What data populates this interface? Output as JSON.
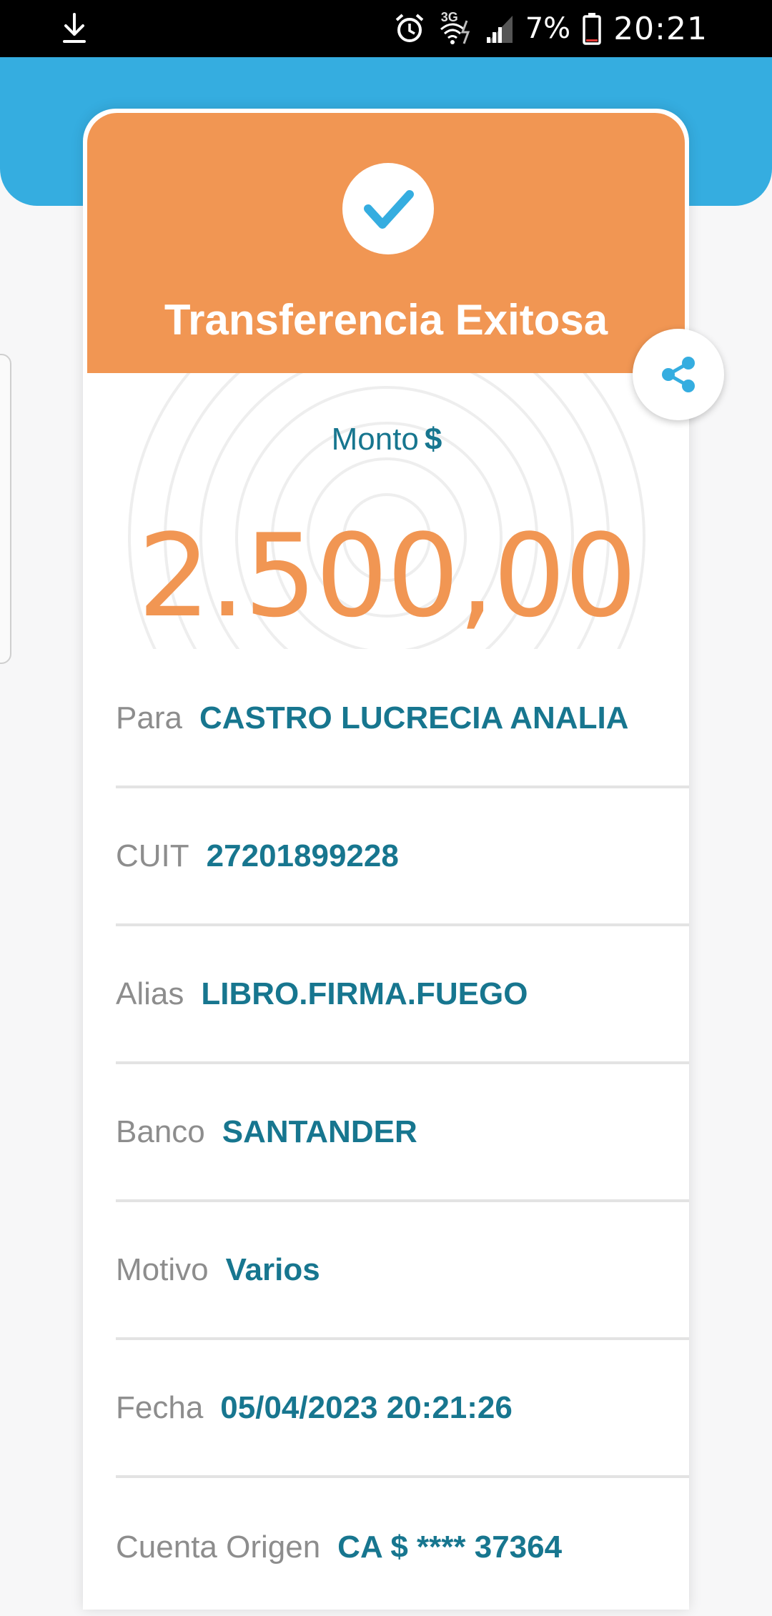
{
  "status_bar": {
    "time": "20:21",
    "battery_percent": "7%",
    "network": "3G",
    "icons": [
      "download-icon",
      "alarm-icon",
      "wifi-icon",
      "signal-icon",
      "battery-icon"
    ]
  },
  "colors": {
    "header_blue": "#35ade0",
    "success_orange": "#f19653",
    "value_teal": "#17768f",
    "label_gray": "#8d8d8d"
  },
  "receipt": {
    "title": "Transferencia Exitosa",
    "amount_label": "Monto",
    "currency_symbol": "$",
    "amount": "2.500,00",
    "details": [
      {
        "label": "Para",
        "value": "CASTRO LUCRECIA ANALIA"
      },
      {
        "label": "CUIT",
        "value": "27201899228"
      },
      {
        "label": "Alias",
        "value": "LIBRO.FIRMA.FUEGO"
      },
      {
        "label": "Banco",
        "value": "SANTANDER"
      },
      {
        "label": "Motivo",
        "value": "Varios"
      },
      {
        "label": "Fecha",
        "value": "05/04/2023 20:21:26"
      },
      {
        "label": "Cuenta Origen",
        "value": "CA $ **** 37364"
      }
    ]
  }
}
